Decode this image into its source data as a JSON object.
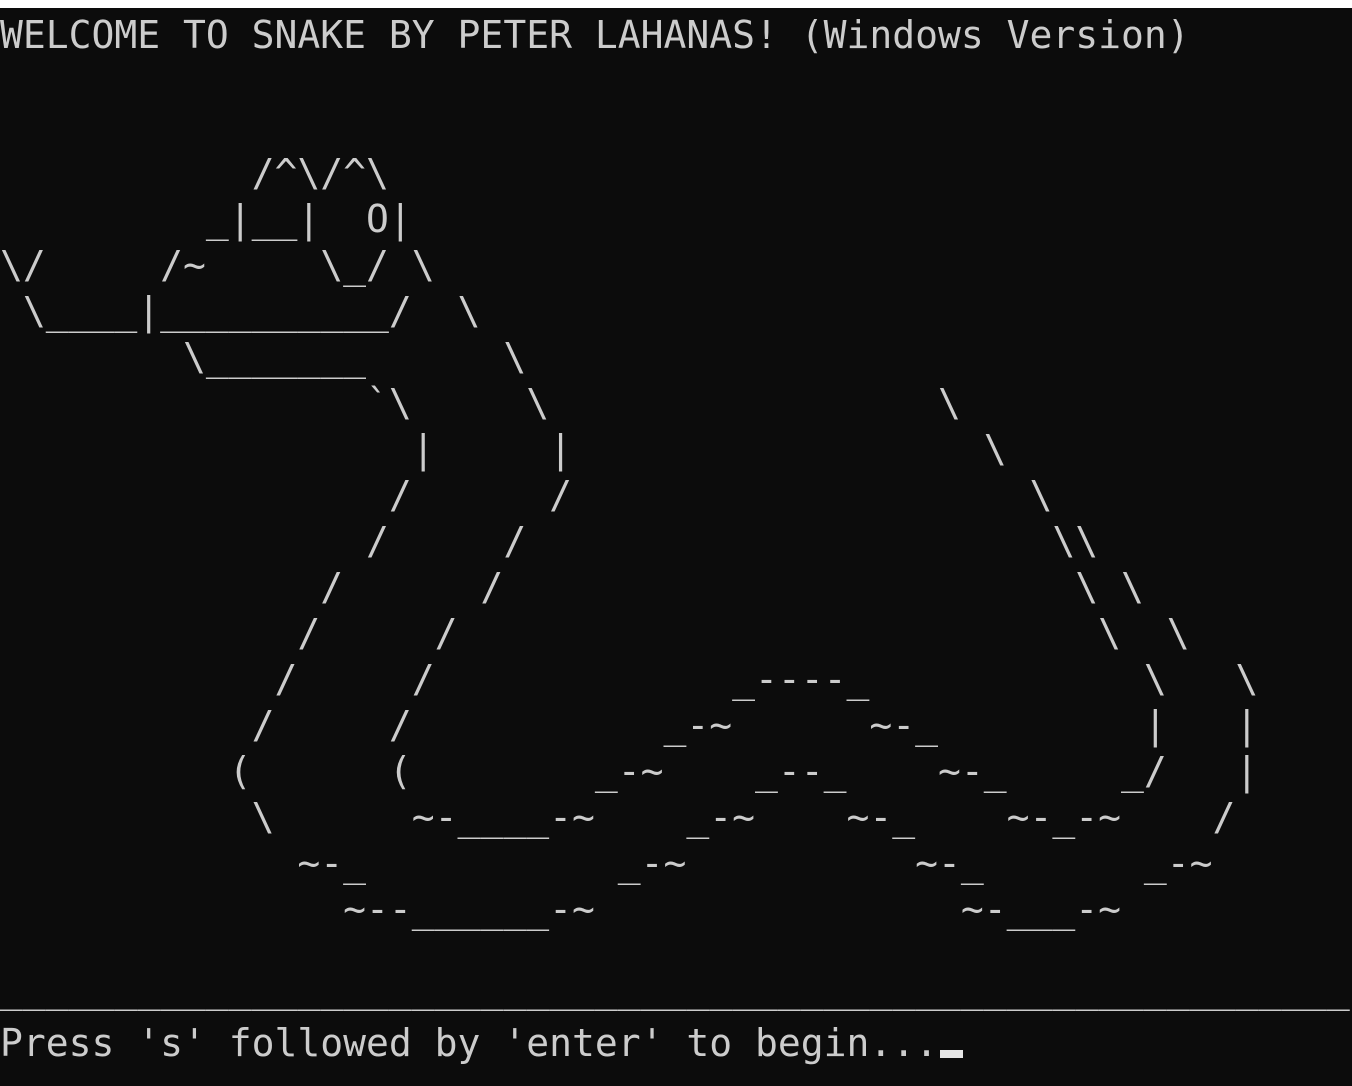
{
  "terminal": {
    "title_line": "WELCOME TO SNAKE BY PETER LAHANAS! (Windows Version)",
    "art_lines": [
      "           /^\\/^\\",
      "         _|__|  O|",
      "\\/     /~     \\_/ \\",
      " \\____|__________/  \\",
      "        \\_______      \\",
      "                `\\     \\                 \\",
      "                  |     |                  \\",
      "                 /      /                    \\",
      "                /     /                       \\\\",
      "              /      /                         \\ \\",
      "             /     /                            \\  \\",
      "            /     /             _----_            \\   \\",
      "           /     /           _-~      ~-_         |   |",
      "          (      (        _-~    _--_    ~-_     _/   |",
      "           \\      ~-____-~    _-~    ~-_    ~-_-~    /",
      "             ~-_           _-~          ~-_       _-~",
      "               ~--______-~                ~-___-~"
    ],
    "divider_line": "___________________________________________________________",
    "prompt_text": "Press 's' followed by 'enter' to begin...",
    "colors": {
      "background": "#0c0c0c",
      "foreground": "#cccccc"
    }
  }
}
